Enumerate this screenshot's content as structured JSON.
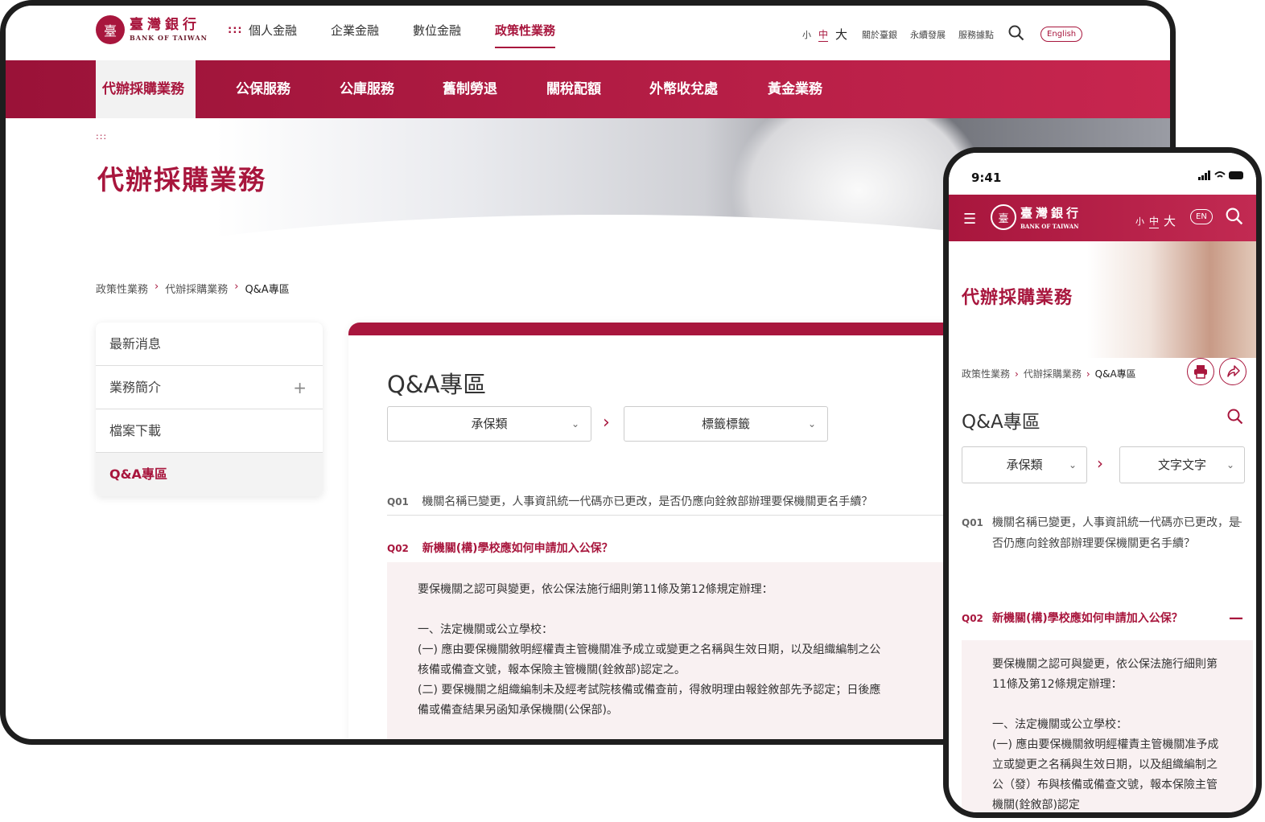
{
  "desktop": {
    "logo": {
      "zh": "臺灣銀行",
      "en": "BANK OF TAIWAN",
      "mark": "臺"
    },
    "main_nav": [
      "個人金融",
      "企業金融",
      "數位金融",
      "政策性業務"
    ],
    "font_sizes": {
      "small": "小",
      "medium": "中",
      "large": "大"
    },
    "util_links": [
      "關於臺銀",
      "永續發展",
      "服務據點"
    ],
    "english_label": "English",
    "sub_nav": [
      "代辦採購業務",
      "公保服務",
      "公庫服務",
      "舊制勞退",
      "關稅配額",
      "外幣收兌處",
      "黃金業務"
    ],
    "hero_title": "代辦採購業務",
    "breadcrumb": [
      "政策性業務",
      "代辦採購業務",
      "Q&A專區"
    ],
    "sidebar": [
      "最新消息",
      "業務簡介",
      "檔案下載",
      "Q&A專區"
    ],
    "panel_title": "Q&A專區",
    "select_1": "承保類",
    "select_2": "標籤標籤",
    "q1": {
      "num": "Q01",
      "text": "機關名稱已變更，人事資訊統一代碼亦已更改，是否仍應向銓敘部辦理要保機關更名手續？"
    },
    "q2": {
      "num": "Q02",
      "text": "新機關(構)學校應如何申請加入公保？"
    },
    "answer": [
      "要保機關之認可與變更，依公保法施行細則第11條及第12條規定辦理：",
      "",
      "一、法定機關或公立學校：",
      "(一) 應由要保機關敘明經權責主管機關准予成立或變更之名稱與生效日期，以及組織編制之公",
      "核備或備查文號，報本保險主管機關(銓敘部)認定之。",
      "(二) 要保機關之組織編制未及經考試院核備或備查前，得敘明理由報銓敘部先予認定；日後應",
      "備或備查結果另函知承保機關(公保部)。"
    ]
  },
  "mobile": {
    "time": "9:41",
    "logo": {
      "zh": "臺灣銀行",
      "en": "BANK OF TAIWAN",
      "mark": "臺"
    },
    "font_sizes": {
      "small": "小",
      "medium": "中",
      "large": "大"
    },
    "en_label": "EN",
    "hero_title": "代辦採購業務",
    "breadcrumb": [
      "政策性業務",
      "代辦採購業務",
      "Q&A專區"
    ],
    "title": "Q&A專區",
    "select_1": "承保類",
    "select_2": "文字文字",
    "q1": {
      "num": "Q01",
      "text": "機關名稱已變更，人事資訊統一代碼亦已更改，是否仍應向銓敘部辦理要保機關更名手續？"
    },
    "q2": {
      "num": "Q02",
      "text": "新機關(構)學校應如何申請加入公保？"
    },
    "answer": [
      "要保機關之認可與變更，依公保法施行細則第11條及第12條規定辦理：",
      "",
      "一、法定機關或公立學校：",
      "(一) 應由要保機關敘明經權責主管機關准予成立或變更之名稱與生效日期，以及組織編制之公（發）布與核備或備查文號，報本保險主管機關(銓敘部)認定"
    ]
  },
  "colors": {
    "brand": "#a8163d",
    "answer_bg": "#f9f1f2"
  }
}
